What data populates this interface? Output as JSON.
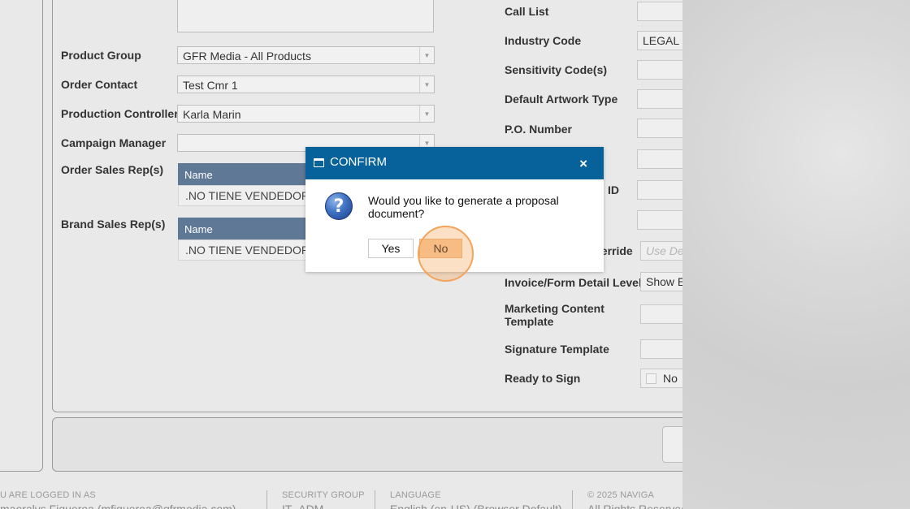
{
  "form": {
    "left_fields": [
      {
        "label": "Product Group",
        "value": "GFR Media - All Products"
      },
      {
        "label": "Order Contact",
        "value": "Test Cmr 1"
      },
      {
        "label": "Production Controller",
        "value": "Karla Marin"
      },
      {
        "label": "Campaign Manager",
        "value": ""
      }
    ],
    "top_textarea_partial": "...",
    "order_sales_reps": {
      "label": "Order Sales Rep(s)",
      "column": "Name",
      "rows": [
        ".NO TIENE VENDEDOR"
      ]
    },
    "brand_sales_reps": {
      "label": "Brand Sales Rep(s)",
      "column": "Name",
      "rows": [
        ".NO TIENE VENDEDOR"
      ]
    },
    "right_fields": [
      {
        "label": "Call List",
        "value": ""
      },
      {
        "label": "Industry Code",
        "value": "LEGAL"
      },
      {
        "label": "Sensitivity Code(s)",
        "value": ""
      },
      {
        "label": "Default Artwork Type",
        "value": ""
      },
      {
        "label": "P.O. Number",
        "value": ""
      },
      {
        "label": "",
        "value": ""
      },
      {
        "label": "ID",
        "value": ""
      },
      {
        "label": "",
        "value": ""
      },
      {
        "label": "verride",
        "value": "",
        "placeholder": "Use De"
      },
      {
        "label": "Invoice/Form Detail Level",
        "value": "Show E"
      },
      {
        "label": "Marketing Content Template",
        "value": ""
      },
      {
        "label": "Signature Template",
        "value": ""
      },
      {
        "label": "Ready to Sign",
        "value": "No"
      }
    ]
  },
  "footer": {
    "logged_in_label": "U ARE LOGGED IN AS",
    "logged_in_value": "maoralys Figueroa (mfigueroa@gfrmedia.com)",
    "security_label": "SECURITY GROUP",
    "security_value": "IT_ADM",
    "language_label": "LANGUAGE",
    "language_value": "English (en-US) (Browser Default)",
    "copyright_label": "© 2025 NAVIGA",
    "copyright_value": "All Rights Reserved"
  },
  "dialog": {
    "title": "CONFIRM",
    "close": "×",
    "message": "Would you like to generate a proposal document?",
    "yes_label": "Yes",
    "no_label": "No",
    "icon_glyph": "?"
  },
  "colors": {
    "dialog_header": "#07629c",
    "grid_header": "#5f7896",
    "highlight": "#f7c89a",
    "click_indicator": "#f4a35a"
  }
}
